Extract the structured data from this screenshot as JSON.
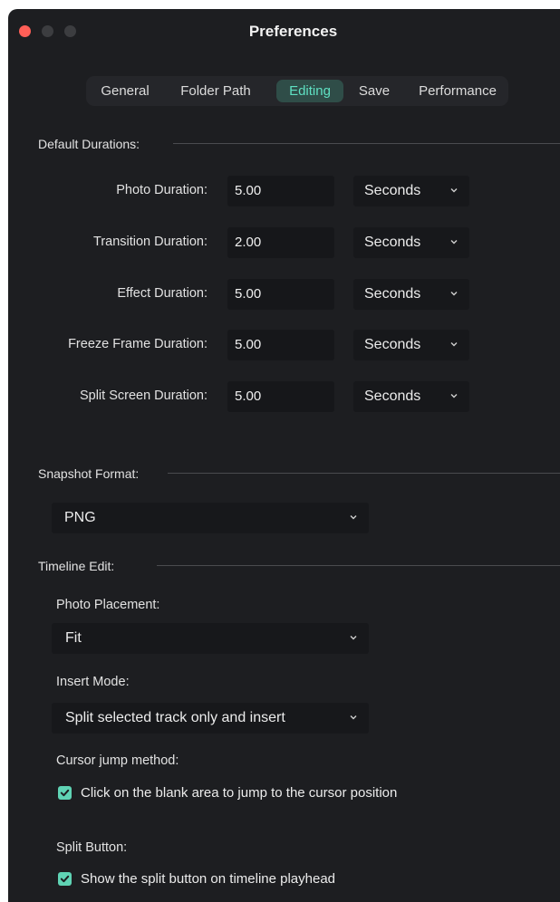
{
  "window": {
    "title": "Preferences"
  },
  "tabs": [
    {
      "label": "General",
      "active": false
    },
    {
      "label": "Folder Path",
      "active": false
    },
    {
      "label": "Editing",
      "active": true
    },
    {
      "label": "Save",
      "active": false
    },
    {
      "label": "Performance",
      "active": false
    }
  ],
  "default_durations": {
    "heading": "Default Durations:",
    "rows": [
      {
        "label": "Photo Duration:",
        "value": "5.00",
        "unit": "Seconds"
      },
      {
        "label": "Transition Duration:",
        "value": "2.00",
        "unit": "Seconds"
      },
      {
        "label": "Effect Duration:",
        "value": "5.00",
        "unit": "Seconds"
      },
      {
        "label": "Freeze Frame Duration:",
        "value": "5.00",
        "unit": "Seconds"
      },
      {
        "label": "Split Screen Duration:",
        "value": "5.00",
        "unit": "Seconds"
      }
    ]
  },
  "snapshot": {
    "heading": "Snapshot Format:",
    "value": "PNG"
  },
  "timeline_edit": {
    "heading": "Timeline Edit:",
    "photo_placement_label": "Photo Placement:",
    "photo_placement_value": "Fit",
    "insert_mode_label": "Insert Mode:",
    "insert_mode_value": "Split selected track only and insert",
    "cursor_jump_label": "Cursor jump method:",
    "cursor_jump_option": "Click on the blank area to jump to the cursor position",
    "cursor_jump_checked": true,
    "split_button_label": "Split Button:",
    "split_button_option": "Show the split button on timeline playhead",
    "split_button_checked": true
  },
  "colors": {
    "accent": "#5fd3b4",
    "active_tab_bg": "#2f4d48",
    "active_tab_text": "#5fe0c2",
    "window_bg": "#1d1e21",
    "close_button": "#ff5f57"
  },
  "icons": {
    "dropdown": "chevron-down-icon",
    "checkbox": "checkmark-icon"
  }
}
